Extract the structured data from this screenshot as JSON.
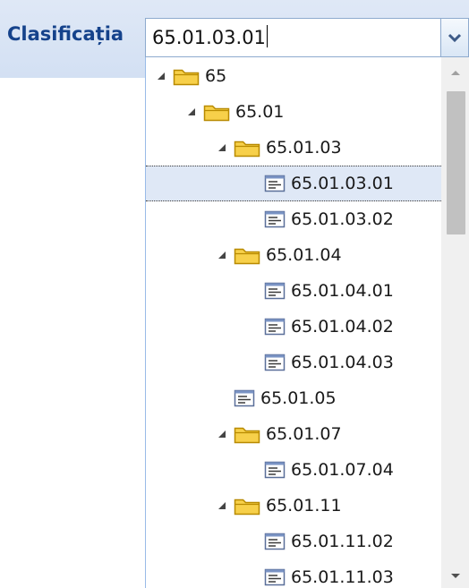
{
  "field": {
    "label": "Clasificația",
    "value": "65.01.03.01"
  },
  "colors": {
    "label": "#15428b",
    "header_bg": "#dfe8f6",
    "selected_bg": "#dfe8f6",
    "folder": "#f5c518",
    "leaf_icon": "#3a5a99"
  },
  "tree": {
    "nodes": [
      {
        "label": "65",
        "type": "folder",
        "expanded": true,
        "depth": 0
      },
      {
        "label": "65.01",
        "type": "folder",
        "expanded": true,
        "depth": 1
      },
      {
        "label": "65.01.03",
        "type": "folder",
        "expanded": true,
        "depth": 2
      },
      {
        "label": "65.01.03.01",
        "type": "leaf",
        "depth": 3,
        "selected": true
      },
      {
        "label": "65.01.03.02",
        "type": "leaf",
        "depth": 3
      },
      {
        "label": "65.01.04",
        "type": "folder",
        "expanded": true,
        "depth": 2
      },
      {
        "label": "65.01.04.01",
        "type": "leaf",
        "depth": 3
      },
      {
        "label": "65.01.04.02",
        "type": "leaf",
        "depth": 3
      },
      {
        "label": "65.01.04.03",
        "type": "leaf",
        "depth": 3
      },
      {
        "label": "65.01.05",
        "type": "leaf",
        "depth": 2
      },
      {
        "label": "65.01.07",
        "type": "folder",
        "expanded": true,
        "depth": 2
      },
      {
        "label": "65.01.07.04",
        "type": "leaf",
        "depth": 3
      },
      {
        "label": "65.01.11",
        "type": "folder",
        "expanded": true,
        "depth": 2
      },
      {
        "label": "65.01.11.02",
        "type": "leaf",
        "depth": 3
      },
      {
        "label": "65.01.11.03",
        "type": "leaf",
        "depth": 3
      }
    ]
  }
}
